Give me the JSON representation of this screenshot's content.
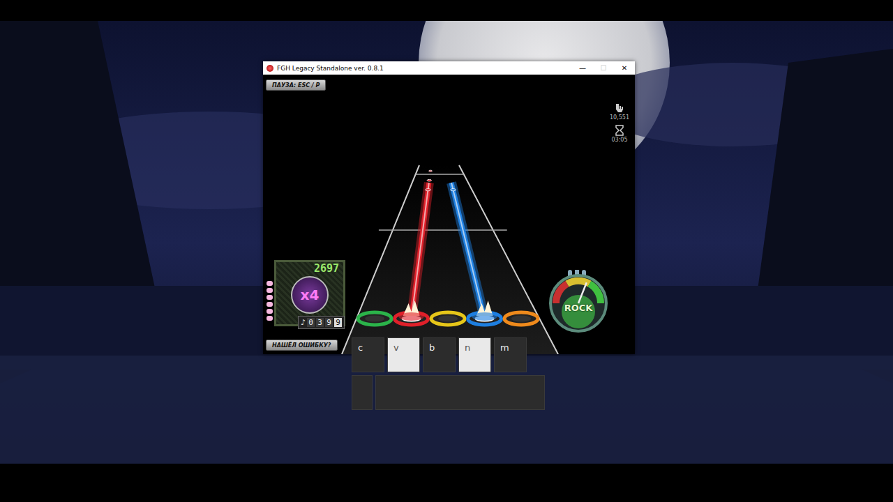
{
  "window": {
    "title": "FGH Legacy Standalone ver. 0.8.1",
    "controls": [
      {
        "label": "—",
        "disabled": false
      },
      {
        "label": "☐",
        "disabled": true
      },
      {
        "label": "✕",
        "disabled": false
      }
    ]
  },
  "pause_button": "ПАУЗА: ESC / P",
  "report_button": "НАШЁЛ ОШИБКУ?",
  "stats": [
    {
      "icon": "rock-hand",
      "value": "10,551"
    },
    {
      "icon": "hourglass",
      "value": "03:05"
    }
  ],
  "score": "2697",
  "multiplier": "x4",
  "note_counter": [
    {
      "digit": "0",
      "highlighted": false
    },
    {
      "digit": "3",
      "highlighted": false
    },
    {
      "digit": "9",
      "highlighted": false
    },
    {
      "digit": "9",
      "highlighted": true
    }
  ],
  "star_power_dots": [
    {
      "lit": true
    },
    {
      "lit": true
    },
    {
      "lit": true
    },
    {
      "lit": true
    },
    {
      "lit": true
    },
    {
      "lit": true
    }
  ],
  "frets": [
    {
      "color": "#2bb34a",
      "pressed": false
    },
    {
      "color": "#e0202a",
      "pressed": true
    },
    {
      "color": "#e6c619",
      "pressed": false
    },
    {
      "color": "#1e7fe0",
      "pressed": true
    },
    {
      "color": "#ef8a1c",
      "pressed": false
    }
  ],
  "notes": [
    {
      "lane": 1,
      "depth": 0.03
    },
    {
      "lane": 1,
      "depth": 0.08
    },
    {
      "lane": 1,
      "depth": 0.13
    },
    {
      "lane": 3,
      "depth": 0.13
    }
  ],
  "rock_meter": {
    "label": "ROCK",
    "level": 0.62
  },
  "keys": [
    {
      "label": "c",
      "pressed": false
    },
    {
      "label": "v",
      "pressed": true
    },
    {
      "label": "b",
      "pressed": false
    },
    {
      "label": "n",
      "pressed": true
    },
    {
      "label": "m",
      "pressed": false
    }
  ],
  "spacebar": {
    "pressed": false
  }
}
